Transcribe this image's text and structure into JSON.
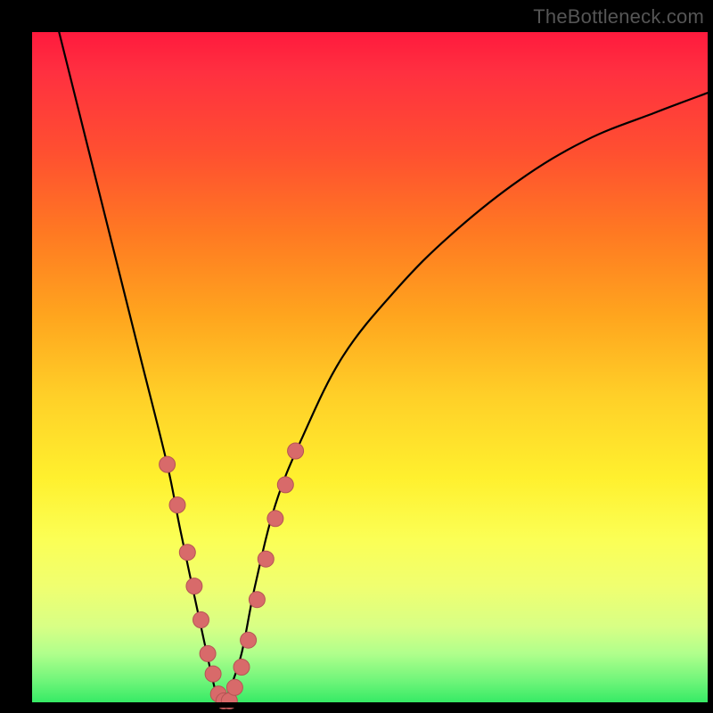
{
  "watermark": "TheBottleneck.com",
  "chart_data": {
    "type": "line",
    "title": "",
    "xlabel": "",
    "ylabel": "",
    "xlim": [
      0,
      100
    ],
    "ylim": [
      0,
      100
    ],
    "background": "gradient-red-to-green-vertical",
    "series": [
      {
        "name": "bottleneck-curve",
        "description": "V-shaped curve; minimum (best/green) near x≈28, rising steeply on both sides toward red",
        "x": [
          4,
          8,
          12,
          16,
          20,
          22,
          25,
          27,
          28,
          29,
          31,
          33,
          36,
          40,
          46,
          54,
          62,
          72,
          82,
          92,
          100
        ],
        "values": [
          100,
          84,
          68,
          52,
          36,
          26,
          12,
          3,
          0,
          2,
          8,
          18,
          30,
          40,
          52,
          62,
          70,
          78,
          84,
          88,
          91
        ]
      }
    ],
    "markers": {
      "name": "highlighted-points",
      "description": "salmon dots along the lower part of the V where curve passes through yellow/green band",
      "x": [
        20.0,
        21.5,
        23.0,
        24.0,
        25.0,
        26.0,
        26.8,
        27.6,
        28.4,
        29.2,
        30.0,
        31.0,
        32.0,
        33.3,
        34.6,
        36.0,
        37.5,
        39.0
      ],
      "values": [
        36,
        30,
        23,
        18,
        13,
        8,
        5,
        2,
        1,
        1,
        3,
        6,
        10,
        16,
        22,
        28,
        33,
        38
      ]
    }
  }
}
